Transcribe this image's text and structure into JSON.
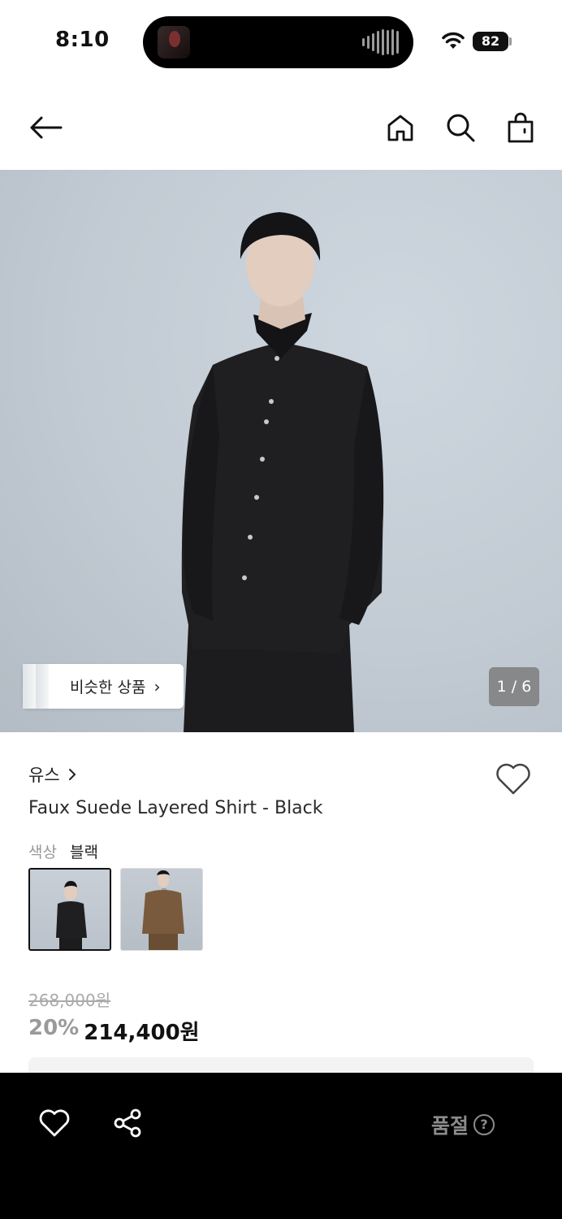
{
  "status_bar": {
    "time": "8:10",
    "battery": "82"
  },
  "nav": {
    "back_icon": "arrow-left-icon",
    "home_icon": "home-icon",
    "search_icon": "search-icon",
    "bag_icon": "shopping-bag-icon"
  },
  "gallery": {
    "similar_label": "비슷한 상품",
    "counter": "1 / 6"
  },
  "product": {
    "brand": "유스",
    "title": "Faux Suede Layered Shirt - Black",
    "color_label": "색상",
    "color_value": "블랙",
    "original_price": "268,000원",
    "discount": "20%",
    "sale_price": "214,400원"
  },
  "bottom_bar": {
    "like_icon": "heart-icon",
    "share_icon": "share-icon",
    "soldout_label": "품절",
    "help_icon": "?"
  },
  "colors": {
    "bottom_bar_bg": "#000000",
    "muted_text": "#8b8b8b",
    "discount_text": "#9a9a9a"
  }
}
